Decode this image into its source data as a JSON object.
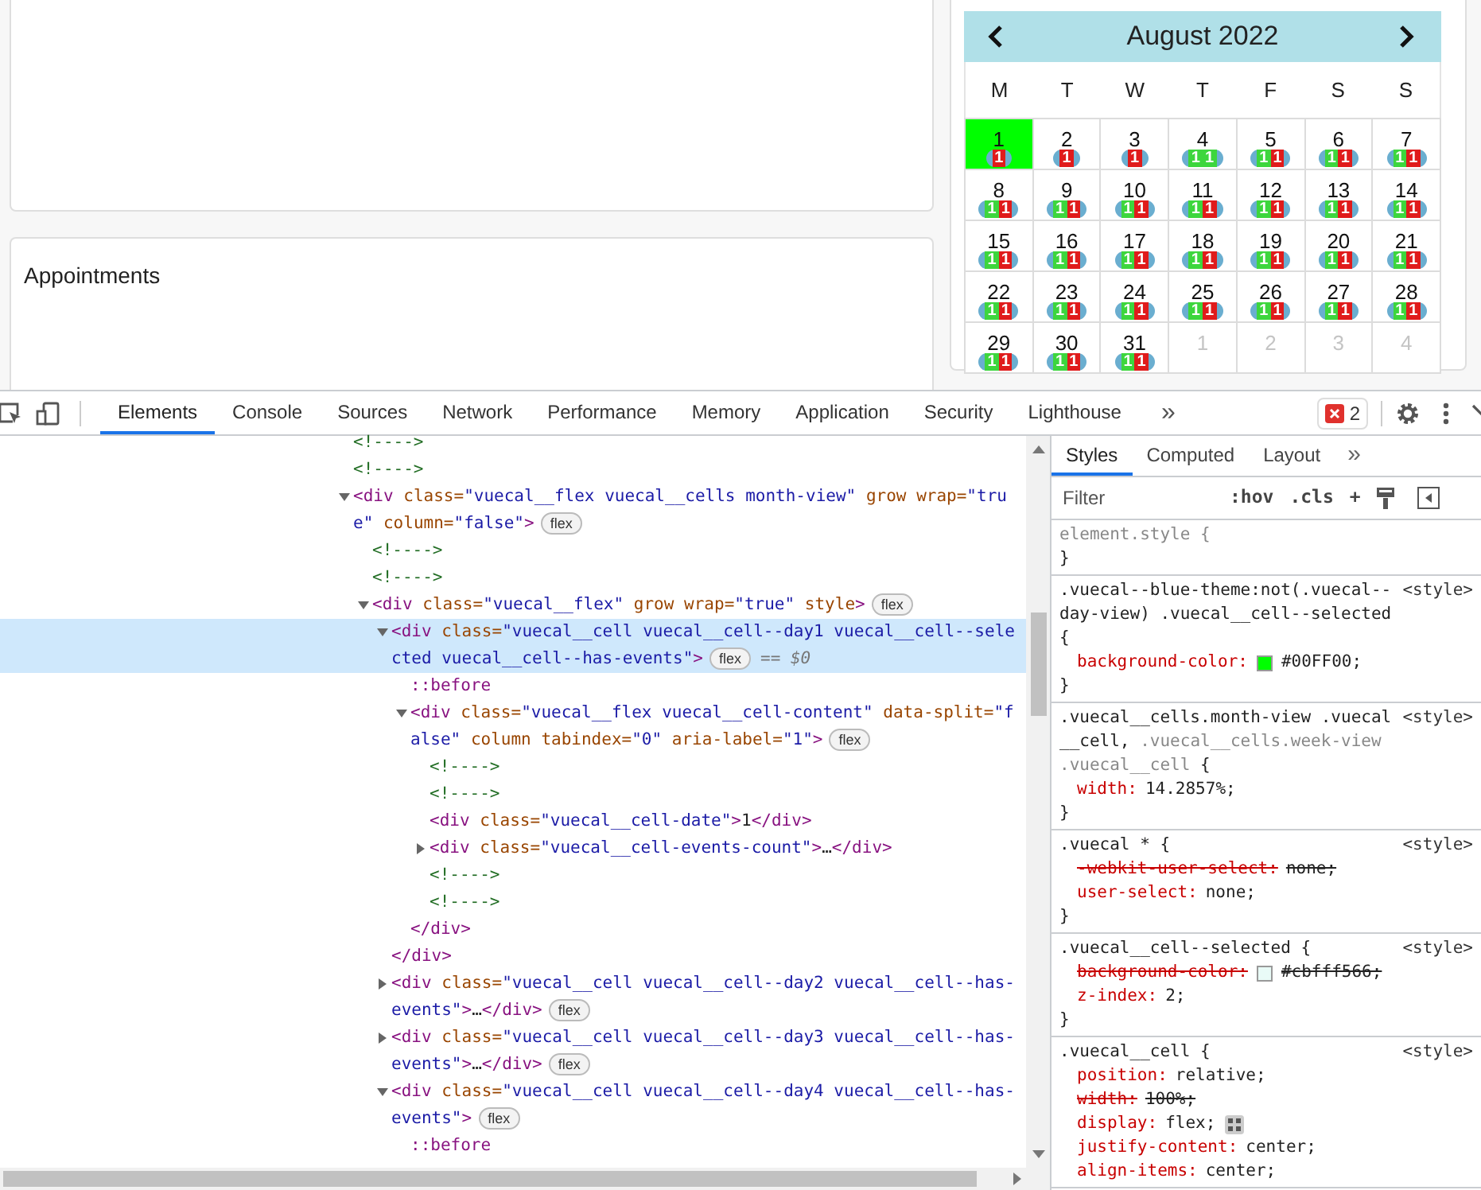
{
  "page": {
    "appointments_card": {
      "title": "Appointments"
    }
  },
  "calendar": {
    "title": "August 2022",
    "weekdays": [
      "M",
      "T",
      "W",
      "T",
      "F",
      "S",
      "S"
    ],
    "weeks": [
      [
        {
          "date": "1",
          "selected": true,
          "faded": false,
          "events": [
            {
              "label": "1",
              "color": "#e01b1b"
            }
          ]
        },
        {
          "date": "2",
          "selected": false,
          "faded": false,
          "events": [
            {
              "label": "1",
              "color": "#e01b1b"
            }
          ]
        },
        {
          "date": "3",
          "selected": false,
          "faded": false,
          "events": [
            {
              "label": "1",
              "color": "#e01b1b"
            }
          ]
        },
        {
          "date": "4",
          "selected": false,
          "faded": false,
          "events": [
            {
              "label": "1",
              "color": "#3dd63d"
            },
            {
              "label": "1",
              "color": "#3dd63d"
            }
          ]
        },
        {
          "date": "5",
          "selected": false,
          "faded": false,
          "events": [
            {
              "label": "1",
              "color": "#3dd63d"
            },
            {
              "label": "1",
              "color": "#e01b1b"
            }
          ]
        },
        {
          "date": "6",
          "selected": false,
          "faded": false,
          "events": [
            {
              "label": "1",
              "color": "#3dd63d"
            },
            {
              "label": "1",
              "color": "#e01b1b"
            }
          ]
        },
        {
          "date": "7",
          "selected": false,
          "faded": false,
          "events": [
            {
              "label": "1",
              "color": "#3dd63d"
            },
            {
              "label": "1",
              "color": "#e01b1b"
            }
          ]
        }
      ],
      [
        {
          "date": "8",
          "selected": false,
          "faded": false,
          "events": [
            {
              "label": "1",
              "color": "#3dd63d"
            },
            {
              "label": "1",
              "color": "#e01b1b"
            }
          ]
        },
        {
          "date": "9",
          "selected": false,
          "faded": false,
          "events": [
            {
              "label": "1",
              "color": "#3dd63d"
            },
            {
              "label": "1",
              "color": "#e01b1b"
            }
          ]
        },
        {
          "date": "10",
          "selected": false,
          "faded": false,
          "events": [
            {
              "label": "1",
              "color": "#3dd63d"
            },
            {
              "label": "1",
              "color": "#e01b1b"
            }
          ]
        },
        {
          "date": "11",
          "selected": false,
          "faded": false,
          "events": [
            {
              "label": "1",
              "color": "#3dd63d"
            },
            {
              "label": "1",
              "color": "#e01b1b"
            }
          ]
        },
        {
          "date": "12",
          "selected": false,
          "faded": false,
          "events": [
            {
              "label": "1",
              "color": "#3dd63d"
            },
            {
              "label": "1",
              "color": "#e01b1b"
            }
          ]
        },
        {
          "date": "13",
          "selected": false,
          "faded": false,
          "events": [
            {
              "label": "1",
              "color": "#3dd63d"
            },
            {
              "label": "1",
              "color": "#e01b1b"
            }
          ]
        },
        {
          "date": "14",
          "selected": false,
          "faded": false,
          "events": [
            {
              "label": "1",
              "color": "#3dd63d"
            },
            {
              "label": "1",
              "color": "#e01b1b"
            }
          ]
        }
      ],
      [
        {
          "date": "15",
          "selected": false,
          "faded": false,
          "events": [
            {
              "label": "1",
              "color": "#3dd63d"
            },
            {
              "label": "1",
              "color": "#e01b1b"
            }
          ]
        },
        {
          "date": "16",
          "selected": false,
          "faded": false,
          "events": [
            {
              "label": "1",
              "color": "#3dd63d"
            },
            {
              "label": "1",
              "color": "#e01b1b"
            }
          ]
        },
        {
          "date": "17",
          "selected": false,
          "faded": false,
          "events": [
            {
              "label": "1",
              "color": "#3dd63d"
            },
            {
              "label": "1",
              "color": "#e01b1b"
            }
          ]
        },
        {
          "date": "18",
          "selected": false,
          "faded": false,
          "events": [
            {
              "label": "1",
              "color": "#3dd63d"
            },
            {
              "label": "1",
              "color": "#e01b1b"
            }
          ]
        },
        {
          "date": "19",
          "selected": false,
          "faded": false,
          "events": [
            {
              "label": "1",
              "color": "#3dd63d"
            },
            {
              "label": "1",
              "color": "#e01b1b"
            }
          ]
        },
        {
          "date": "20",
          "selected": false,
          "faded": false,
          "events": [
            {
              "label": "1",
              "color": "#3dd63d"
            },
            {
              "label": "1",
              "color": "#e01b1b"
            }
          ]
        },
        {
          "date": "21",
          "selected": false,
          "faded": false,
          "events": [
            {
              "label": "1",
              "color": "#3dd63d"
            },
            {
              "label": "1",
              "color": "#e01b1b"
            }
          ]
        }
      ],
      [
        {
          "date": "22",
          "selected": false,
          "faded": false,
          "events": [
            {
              "label": "1",
              "color": "#3dd63d"
            },
            {
              "label": "1",
              "color": "#e01b1b"
            }
          ]
        },
        {
          "date": "23",
          "selected": false,
          "faded": false,
          "events": [
            {
              "label": "1",
              "color": "#3dd63d"
            },
            {
              "label": "1",
              "color": "#e01b1b"
            }
          ]
        },
        {
          "date": "24",
          "selected": false,
          "faded": false,
          "events": [
            {
              "label": "1",
              "color": "#3dd63d"
            },
            {
              "label": "1",
              "color": "#e01b1b"
            }
          ]
        },
        {
          "date": "25",
          "selected": false,
          "faded": false,
          "events": [
            {
              "label": "1",
              "color": "#3dd63d"
            },
            {
              "label": "1",
              "color": "#e01b1b"
            }
          ]
        },
        {
          "date": "26",
          "selected": false,
          "faded": false,
          "events": [
            {
              "label": "1",
              "color": "#3dd63d"
            },
            {
              "label": "1",
              "color": "#e01b1b"
            }
          ]
        },
        {
          "date": "27",
          "selected": false,
          "faded": false,
          "events": [
            {
              "label": "1",
              "color": "#3dd63d"
            },
            {
              "label": "1",
              "color": "#e01b1b"
            }
          ]
        },
        {
          "date": "28",
          "selected": false,
          "faded": false,
          "events": [
            {
              "label": "1",
              "color": "#3dd63d"
            },
            {
              "label": "1",
              "color": "#e01b1b"
            }
          ]
        }
      ],
      [
        {
          "date": "29",
          "selected": false,
          "faded": false,
          "events": [
            {
              "label": "1",
              "color": "#3dd63d"
            },
            {
              "label": "1",
              "color": "#e01b1b"
            }
          ]
        },
        {
          "date": "30",
          "selected": false,
          "faded": false,
          "events": [
            {
              "label": "1",
              "color": "#3dd63d"
            },
            {
              "label": "1",
              "color": "#e01b1b"
            }
          ]
        },
        {
          "date": "31",
          "selected": false,
          "faded": false,
          "events": [
            {
              "label": "1",
              "color": "#3dd63d"
            },
            {
              "label": "1",
              "color": "#e01b1b"
            }
          ]
        },
        {
          "date": "1",
          "selected": false,
          "faded": true
        },
        {
          "date": "2",
          "selected": false,
          "faded": true
        },
        {
          "date": "3",
          "selected": false,
          "faded": true
        },
        {
          "date": "4",
          "selected": false,
          "faded": true
        }
      ]
    ]
  },
  "devtools": {
    "tabs": [
      {
        "label": "Elements",
        "selected": true
      },
      {
        "label": "Console",
        "selected": false
      },
      {
        "label": "Sources",
        "selected": false
      },
      {
        "label": "Network",
        "selected": false
      },
      {
        "label": "Performance",
        "selected": false
      },
      {
        "label": "Memory",
        "selected": false
      },
      {
        "label": "Application",
        "selected": false
      },
      {
        "label": "Security",
        "selected": false
      },
      {
        "label": "Lighthouse",
        "selected": false
      }
    ],
    "more_tabs": "»",
    "error_count": "2",
    "dom_tree": [
      {
        "kind": "comment",
        "text": "<!---->"
      },
      {
        "kind": "comment",
        "text": "<!---->"
      },
      {
        "kind": "element",
        "text": "<div class=\"vuecal__flex vuecal__cells month-view\" grow wrap=\"true\" column=\"false\">",
        "badge": "flex",
        "expanded": true,
        "selected": false,
        "children": [
          {
            "kind": "comment",
            "text": "<!---->"
          },
          {
            "kind": "comment",
            "text": "<!---->"
          },
          {
            "kind": "element",
            "text": "<div class=\"vuecal__flex\" grow wrap=\"true\" style>",
            "badge": "flex",
            "expanded": true,
            "selected": false,
            "children": [
              {
                "kind": "element",
                "text": "<div class=\"vuecal__cell vuecal__cell--day1 vuecal__cell--selected vuecal__cell--has-events\">",
                "badge": "flex",
                "note": "== $0",
                "expanded": true,
                "selected": true,
                "closing": "</div>",
                "children": [
                  {
                    "kind": "pseudo",
                    "text": "::before"
                  },
                  {
                    "kind": "element",
                    "text": "<div class=\"vuecal__flex vuecal__cell-content\" data-split=\"false\" column tabindex=\"0\" aria-label=\"1\">",
                    "badge": "flex",
                    "expanded": true,
                    "selected": false,
                    "closing": "</div>",
                    "children": [
                      {
                        "kind": "comment",
                        "text": "<!---->"
                      },
                      {
                        "kind": "comment",
                        "text": "<!---->"
                      },
                      {
                        "kind": "element",
                        "text": "<div class=\"vuecal__cell-date\">1</div>",
                        "selected": false
                      },
                      {
                        "kind": "element",
                        "text": "<div class=\"vuecal__cell-events-count\">…</div>",
                        "expanded": false,
                        "selected": false
                      },
                      {
                        "kind": "comment",
                        "text": "<!---->"
                      },
                      {
                        "kind": "comment",
                        "text": "<!---->"
                      }
                    ]
                  }
                ]
              },
              {
                "kind": "element",
                "text": "<div class=\"vuecal__cell vuecal__cell--day2 vuecal__cell--has-events\">…</div>",
                "badge": "flex",
                "expanded": false,
                "selected": false
              },
              {
                "kind": "element",
                "text": "<div class=\"vuecal__cell vuecal__cell--day3 vuecal__cell--has-events\">…</div>",
                "badge": "flex",
                "expanded": false,
                "selected": false
              },
              {
                "kind": "element",
                "text": "<div class=\"vuecal__cell vuecal__cell--day4 vuecal__cell--has-events\">",
                "badge": "flex",
                "expanded": true,
                "selected": false,
                "children": [
                  {
                    "kind": "pseudo",
                    "text": "::before"
                  }
                ]
              }
            ]
          }
        ]
      }
    ],
    "side_tabs": [
      {
        "label": "Styles",
        "selected": true
      },
      {
        "label": "Computed",
        "selected": false
      },
      {
        "label": "Layout",
        "selected": false
      }
    ],
    "side_more": "»",
    "filter": {
      "placeholder": "Filter"
    },
    "filter_buttons": [
      ":hov",
      ".cls",
      "+"
    ],
    "rules": [
      {
        "selector": [
          {
            "text": "element.style {",
            "matched": false
          }
        ],
        "close": "}"
      },
      {
        "selector": [
          {
            "text": ".vuecal--blue-theme:not(.vuecal--day-view) .vuecal__cell--selected {",
            "matched": true
          }
        ],
        "source": "<style>",
        "props": [
          {
            "name": "background-color:",
            "value": "#00FF00;",
            "struck": false,
            "color": "#00ff00"
          }
        ],
        "close": "}"
      },
      {
        "selector": [
          {
            "text": ".vuecal__cells.month-view .vuecal__cell,",
            "matched": true
          },
          {
            "text": ".vuecal__cells.week-view .vuecal__cell",
            "matched": false
          },
          {
            "text": "{",
            "matched": true
          }
        ],
        "source": "<style>",
        "props": [
          {
            "name": "width:",
            "value": "14.2857%;",
            "struck": false
          }
        ],
        "close": "}"
      },
      {
        "selector": [
          {
            "text": ".vuecal * {",
            "matched": true
          }
        ],
        "source": "<style>",
        "props": [
          {
            "name": "-webkit-user-select:",
            "value": "none;",
            "struck": true
          },
          {
            "name": "user-select:",
            "value": "none;",
            "struck": false
          }
        ],
        "close": "}"
      },
      {
        "selector": [
          {
            "text": ".vuecal__cell--selected {",
            "matched": true
          }
        ],
        "source": "<style>",
        "props": [
          {
            "name": "background-color:",
            "value": "#cbfff566;",
            "struck": true,
            "color": "#e9fbf7"
          },
          {
            "name": "z-index:",
            "value": "2;",
            "struck": false
          }
        ],
        "close": "}"
      },
      {
        "selector": [
          {
            "text": ".vuecal__cell {",
            "matched": true
          }
        ],
        "source": "<style>",
        "props": [
          {
            "name": "position:",
            "value": "relative;",
            "struck": false
          },
          {
            "name": "width:",
            "value": "100%;",
            "struck": true
          },
          {
            "name": "display:",
            "value": "flex;",
            "struck": false,
            "editor": true
          },
          {
            "name": "justify-content:",
            "value": "center;",
            "struck": false
          },
          {
            "name": "align-items:",
            "value": "center;",
            "struck": false
          }
        ]
      }
    ]
  }
}
